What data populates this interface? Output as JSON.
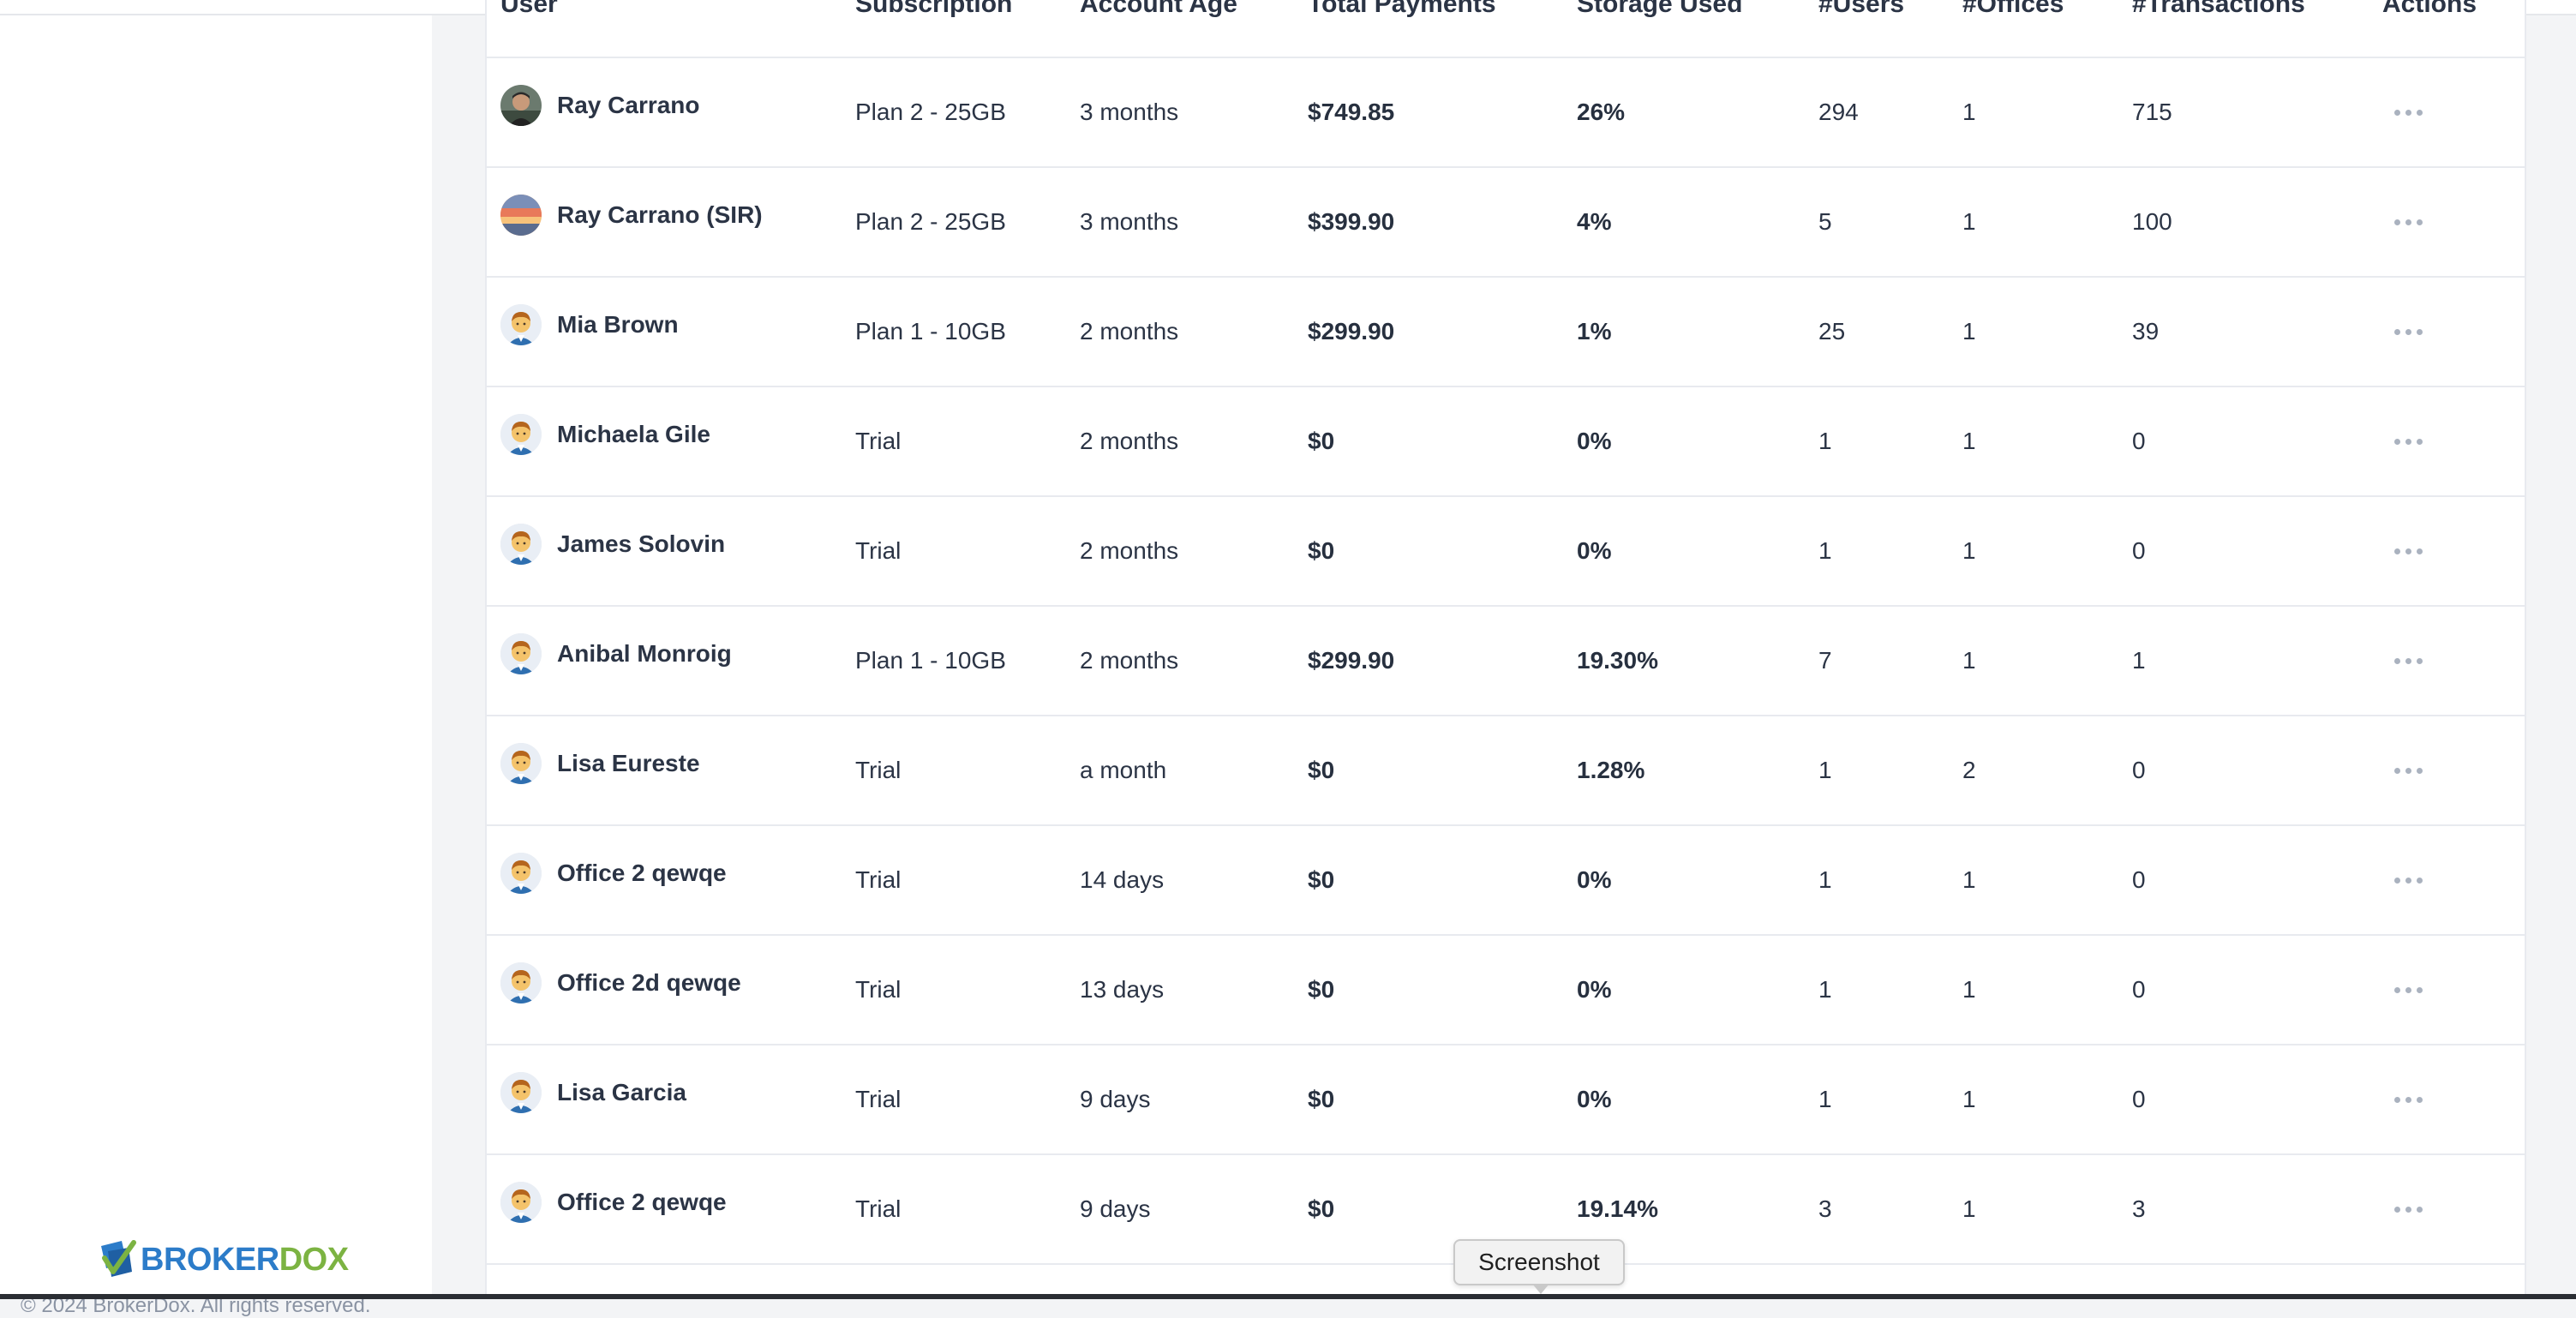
{
  "table": {
    "columns": [
      "User",
      "Subscription",
      "Account Age",
      "Total Payments",
      "Storage Used",
      "#Users",
      "#Offices",
      "#Transactions",
      "Actions"
    ],
    "rows": [
      {
        "user": "Ray Carrano",
        "avatar": "photo-avatar",
        "subscription": "Plan 2 - 25GB",
        "age": "3 months",
        "payments": "$749.85",
        "storage": "26%",
        "users": "294",
        "offices": "1",
        "transactions": "715"
      },
      {
        "user": "Ray Carrano (SIR)",
        "avatar": "sunset-avatar",
        "subscription": "Plan 2 - 25GB",
        "age": "3 months",
        "payments": "$399.90",
        "storage": "4%",
        "users": "5",
        "offices": "1",
        "transactions": "100"
      },
      {
        "user": "Mia Brown",
        "avatar": "default-avatar",
        "subscription": "Plan 1 - 10GB",
        "age": "2 months",
        "payments": "$299.90",
        "storage": "1%",
        "users": "25",
        "offices": "1",
        "transactions": "39"
      },
      {
        "user": "Michaela Gile",
        "avatar": "default-avatar",
        "subscription": "Trial",
        "age": "2 months",
        "payments": "$0",
        "storage": "0%",
        "users": "1",
        "offices": "1",
        "transactions": "0"
      },
      {
        "user": "James Solovin",
        "avatar": "default-avatar",
        "subscription": "Trial",
        "age": "2 months",
        "payments": "$0",
        "storage": "0%",
        "users": "1",
        "offices": "1",
        "transactions": "0"
      },
      {
        "user": "Anibal Monroig",
        "avatar": "default-avatar",
        "subscription": "Plan 1 - 10GB",
        "age": "2 months",
        "payments": "$299.90",
        "storage": "19.30%",
        "users": "7",
        "offices": "1",
        "transactions": "1"
      },
      {
        "user": "Lisa Eureste",
        "avatar": "default-avatar",
        "subscription": "Trial",
        "age": "a month",
        "payments": "$0",
        "storage": "1.28%",
        "users": "1",
        "offices": "2",
        "transactions": "0"
      },
      {
        "user": "Office 2 qewqe",
        "avatar": "default-avatar",
        "subscription": "Trial",
        "age": "14 days",
        "payments": "$0",
        "storage": "0%",
        "users": "1",
        "offices": "1",
        "transactions": "0"
      },
      {
        "user": "Office 2d qewqe",
        "avatar": "default-avatar",
        "subscription": "Trial",
        "age": "13 days",
        "payments": "$0",
        "storage": "0%",
        "users": "1",
        "offices": "1",
        "transactions": "0"
      },
      {
        "user": "Lisa Garcia",
        "avatar": "default-avatar",
        "subscription": "Trial",
        "age": "9 days",
        "payments": "$0",
        "storage": "0%",
        "users": "1",
        "offices": "1",
        "transactions": "0"
      },
      {
        "user": "Office 2 qewqe",
        "avatar": "default-avatar",
        "subscription": "Trial",
        "age": "9 days",
        "payments": "$0",
        "storage": "19.14%",
        "users": "3",
        "offices": "1",
        "transactions": "3"
      }
    ],
    "actions_icon": "more-horizontal-icon"
  },
  "sidebar": {
    "brand_part1": "BROKER",
    "brand_part2": "DOX",
    "brand_icon": "brokerdox-logo-icon",
    "copyright": "© 2024 BrokerDox. All rights reserved."
  },
  "tooltip": {
    "label": "Screenshot"
  },
  "colors": {
    "brand_blue": "#2c7cc9",
    "brand_green": "#7cb342",
    "text": "#2b3445",
    "border": "#e8eaef"
  }
}
